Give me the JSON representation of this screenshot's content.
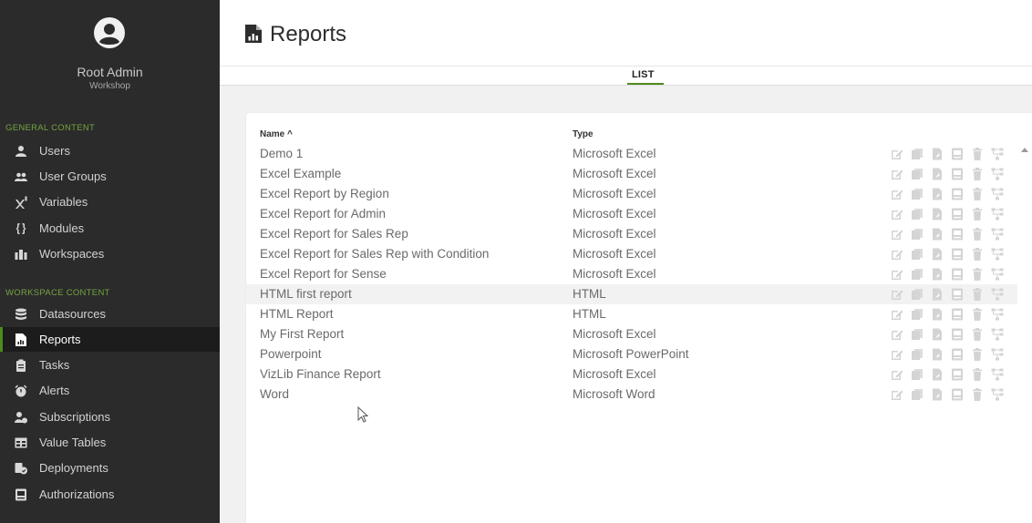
{
  "user": {
    "name": "Root Admin",
    "org": "Workshop",
    "avatar_icon": "user-circle-icon"
  },
  "sidebar": {
    "sections": [
      {
        "title": "GENERAL CONTENT"
      },
      {
        "title": "WORKSPACE CONTENT"
      }
    ],
    "items": [
      {
        "label": "Users",
        "icon": "user-icon"
      },
      {
        "label": "User Groups",
        "icon": "users-icon"
      },
      {
        "label": "Variables",
        "icon": "superscript-icon"
      },
      {
        "label": "Modules",
        "icon": "braces-icon"
      },
      {
        "label": "Workspaces",
        "icon": "columns-icon"
      },
      {
        "label": "Datasources",
        "icon": "database-icon"
      },
      {
        "label": "Reports",
        "icon": "report-icon",
        "active": true
      },
      {
        "label": "Tasks",
        "icon": "clipboard-icon"
      },
      {
        "label": "Alerts",
        "icon": "alarm-icon"
      },
      {
        "label": "Subscriptions",
        "icon": "user-subscribe-icon"
      },
      {
        "label": "Value Tables",
        "icon": "table-icon"
      },
      {
        "label": "Deployments",
        "icon": "deploy-icon"
      },
      {
        "label": "Authorizations",
        "icon": "auth-icon"
      }
    ]
  },
  "header": {
    "title": "Reports",
    "icon": "report-icon"
  },
  "tabs": [
    {
      "label": "LIST",
      "active": true
    }
  ],
  "table": {
    "columns": {
      "name": "Name ^",
      "type": "Type"
    },
    "rows": [
      {
        "name": "Demo 1",
        "type": "Microsoft Excel"
      },
      {
        "name": "Excel Example",
        "type": "Microsoft Excel"
      },
      {
        "name": "Excel Report by Region",
        "type": "Microsoft Excel"
      },
      {
        "name": "Excel Report for Admin",
        "type": "Microsoft Excel"
      },
      {
        "name": "Excel Report for Sales Rep",
        "type": "Microsoft Excel"
      },
      {
        "name": "Excel Report for Sales Rep with Condition",
        "type": "Microsoft Excel"
      },
      {
        "name": "Excel Report for Sense",
        "type": "Microsoft Excel"
      },
      {
        "name": "HTML first report",
        "type": "HTML",
        "hover": true
      },
      {
        "name": "HTML Report",
        "type": "HTML"
      },
      {
        "name": "My First Report",
        "type": "Microsoft Excel"
      },
      {
        "name": "Powerpoint",
        "type": "Microsoft PowerPoint"
      },
      {
        "name": "VizLib Finance Report",
        "type": "Microsoft Excel"
      },
      {
        "name": "Word",
        "type": "Microsoft Word"
      }
    ],
    "row_actions": [
      "edit-icon",
      "copy-icon",
      "preview-icon",
      "schedule-icon",
      "delete-icon",
      "dependencies-icon"
    ]
  },
  "colors": {
    "accent": "#4d8b1e",
    "section_title": "#74a43f",
    "sidebar_bg": "#2b2b2b",
    "action_icon": "#d4d4d4"
  }
}
